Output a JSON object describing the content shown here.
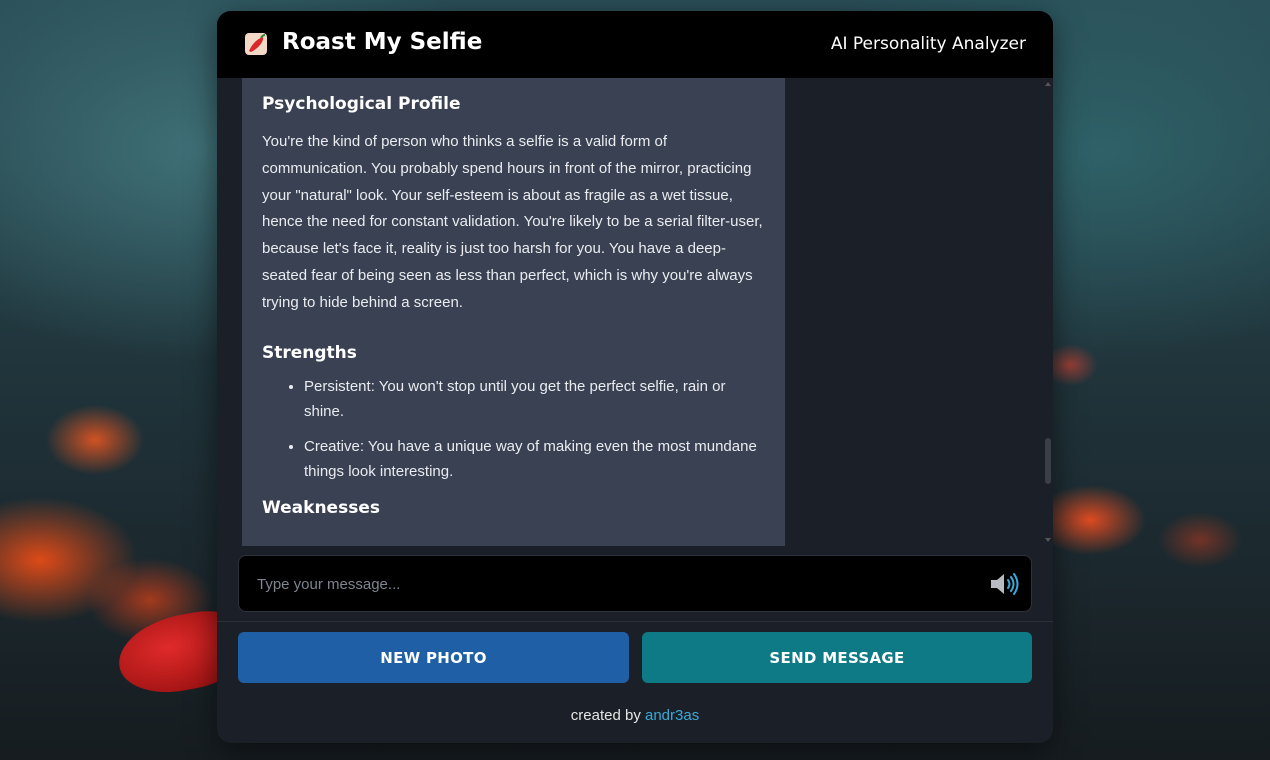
{
  "header": {
    "logo_icon": "chili-pepper-icon",
    "title": "Roast My Selfie",
    "subtitle": "AI Personality Analyzer"
  },
  "chat": {
    "message": {
      "section1_title": "Psychological Profile",
      "section1_body": "You're the kind of person who thinks a selfie is a valid form of communication. You probably spend hours in front of the mirror, practicing your \"natural\" look. Your self-esteem is about as fragile as a wet tissue, hence the need for constant validation. You're likely to be a serial filter-user, because let's face it, reality is just too harsh for you. You have a deep-seated fear of being seen as less than perfect, which is why you're always trying to hide behind a screen.",
      "section2_title": "Strengths",
      "strengths": [
        "Persistent: You won't stop until you get the perfect selfie, rain or shine.",
        "Creative: You have a unique way of making even the most mundane things look interesting."
      ],
      "section3_title": "Weaknesses"
    }
  },
  "input": {
    "placeholder": "Type your message...",
    "value": "",
    "speaker_icon": "speaker-icon"
  },
  "buttons": {
    "new_photo": "NEW PHOTO",
    "send_message": "SEND MESSAGE"
  },
  "footer": {
    "prefix": "created by",
    "author": "andr3as"
  },
  "colors": {
    "header_bg": "#000000",
    "card_bg": "#1b2028",
    "message_bg": "#394152",
    "new_photo_btn": "#1f5fa6",
    "send_btn": "#0e7a85",
    "link": "#39a9d8"
  }
}
